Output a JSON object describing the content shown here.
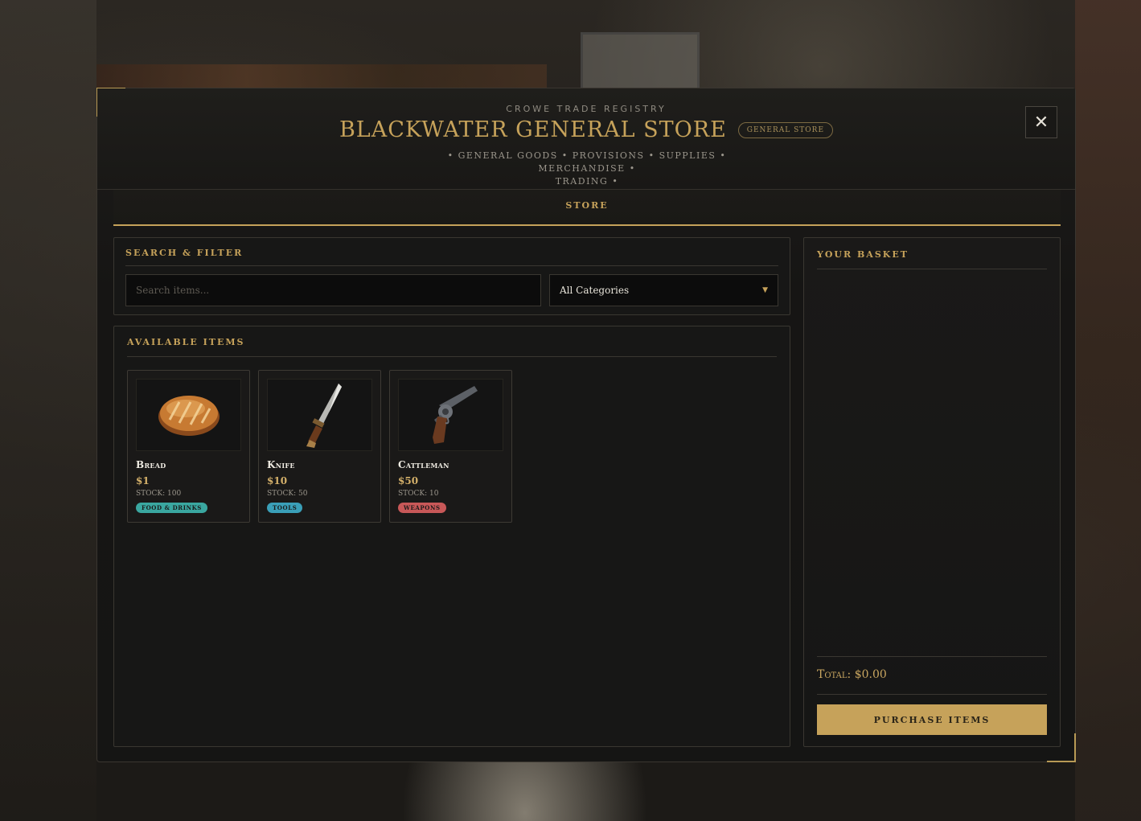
{
  "header": {
    "subtitle": "Crowe Trade Registry",
    "title": "Blackwater General Store",
    "store_type_badge": "General Store",
    "tagline_line1": "• General Goods • Provisions • Supplies • Merchandise •",
    "tagline_line2": "Trading •",
    "close_label": "✕"
  },
  "tabs": [
    {
      "label": "Store",
      "active": true
    }
  ],
  "search": {
    "section_title": "Search & Filter",
    "placeholder": "Search items...",
    "category_selected": "All Categories"
  },
  "items": {
    "section_title": "Available Items",
    "list": [
      {
        "name": "Bread",
        "price": "$1",
        "stock": "Stock: 100",
        "category": "Food & Drinks",
        "category_color": "#3aa7a0",
        "icon": "bread-icon"
      },
      {
        "name": "Knife",
        "price": "$10",
        "stock": "Stock: 50",
        "category": "Tools",
        "category_color": "#3a9fb8",
        "icon": "knife-icon"
      },
      {
        "name": "Cattleman",
        "price": "$50",
        "stock": "Stock: 10",
        "category": "Weapons",
        "category_color": "#c85858",
        "icon": "revolver-icon"
      }
    ]
  },
  "basket": {
    "title": "Your Basket",
    "total": "Total: $0.00",
    "purchase_label": "Purchase Items"
  },
  "colors": {
    "accent_gold": "#c6a25a",
    "panel_bg": "#171716",
    "border": "#3a3731"
  }
}
